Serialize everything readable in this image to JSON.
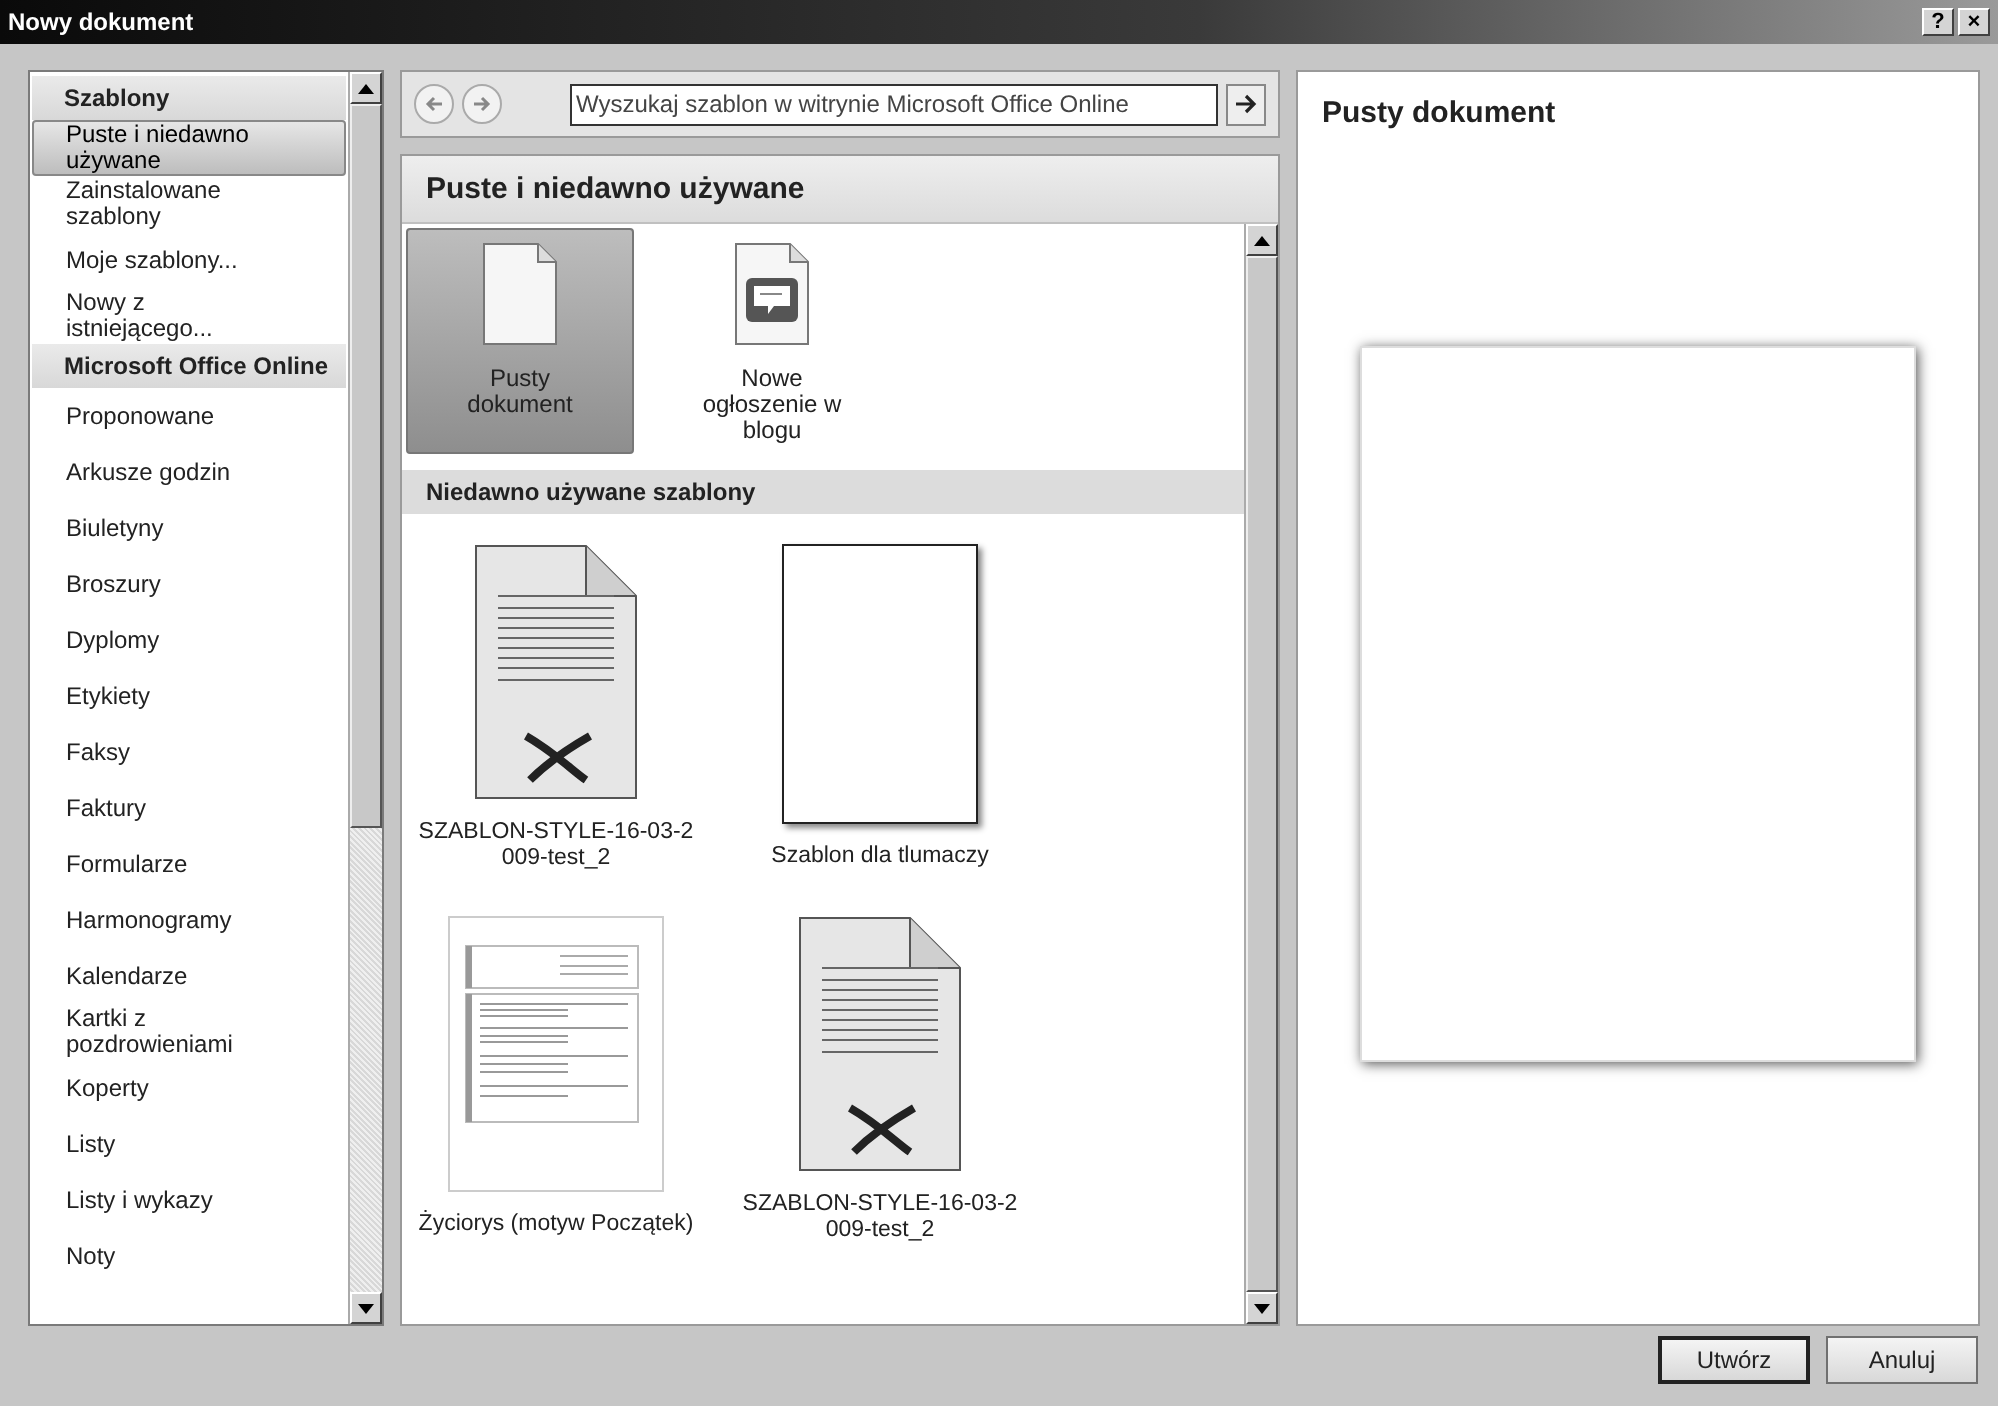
{
  "window": {
    "title": "Nowy dokument",
    "help_button": "?",
    "close_button": "×"
  },
  "sidebar": {
    "items": [
      {
        "label": "Szablony",
        "kind": "header"
      },
      {
        "label": "Puste i niedawno używane",
        "kind": "item",
        "selected": true
      },
      {
        "label": "Zainstalowane szablony",
        "kind": "item",
        "selected": false
      },
      {
        "label": "Moje szablony...",
        "kind": "item",
        "selected": false
      },
      {
        "label": "Nowy z istniejącego...",
        "kind": "item",
        "selected": false
      },
      {
        "label": "Microsoft Office Online",
        "kind": "header"
      },
      {
        "label": "Proponowane",
        "kind": "item",
        "selected": false
      },
      {
        "label": "Arkusze godzin",
        "kind": "item",
        "selected": false
      },
      {
        "label": "Biuletyny",
        "kind": "item",
        "selected": false
      },
      {
        "label": "Broszury",
        "kind": "item",
        "selected": false
      },
      {
        "label": "Dyplomy",
        "kind": "item",
        "selected": false
      },
      {
        "label": "Etykiety",
        "kind": "item",
        "selected": false
      },
      {
        "label": "Faksy",
        "kind": "item",
        "selected": false
      },
      {
        "label": "Faktury",
        "kind": "item",
        "selected": false
      },
      {
        "label": "Formularze",
        "kind": "item",
        "selected": false
      },
      {
        "label": "Harmonogramy",
        "kind": "item",
        "selected": false
      },
      {
        "label": "Kalendarze",
        "kind": "item",
        "selected": false
      },
      {
        "label": "Kartki z pozdrowieniami",
        "kind": "item",
        "selected": false
      },
      {
        "label": "Koperty",
        "kind": "item",
        "selected": false
      },
      {
        "label": "Listy",
        "kind": "item",
        "selected": false
      },
      {
        "label": "Listy i wykazy",
        "kind": "item",
        "selected": false
      },
      {
        "label": "Noty",
        "kind": "item",
        "selected": false
      }
    ]
  },
  "search": {
    "placeholder": "Wyszukaj szablon w witrynie Microsoft Office Online"
  },
  "content": {
    "title": "Puste i niedawno używane",
    "sections": [
      {
        "templates": [
          {
            "label": "Pusty dokument",
            "kind": "blank",
            "selected": true
          },
          {
            "label": "Nowe ogłoszenie w blogu",
            "kind": "blog",
            "selected": false
          }
        ]
      },
      {
        "title": "Niedawno używane szablony",
        "templates": [
          {
            "label": "SZABLON-STYLE-16-03-2 009-test_2",
            "kind": "doc",
            "selected": false
          },
          {
            "label": "Szablon dla tlumaczy",
            "kind": "page",
            "selected": false
          },
          {
            "label": "Życiorys (motyw Początek)",
            "kind": "resume",
            "selected": false
          },
          {
            "label": "SZABLON-STYLE-16-03-2 009-test_2",
            "kind": "doc",
            "selected": false
          }
        ]
      }
    ]
  },
  "preview": {
    "title": "Pusty dokument"
  },
  "buttons": [
    {
      "label": "Utwórz",
      "kind": "default"
    },
    {
      "label": "Anuluj",
      "kind": "normal"
    }
  ]
}
